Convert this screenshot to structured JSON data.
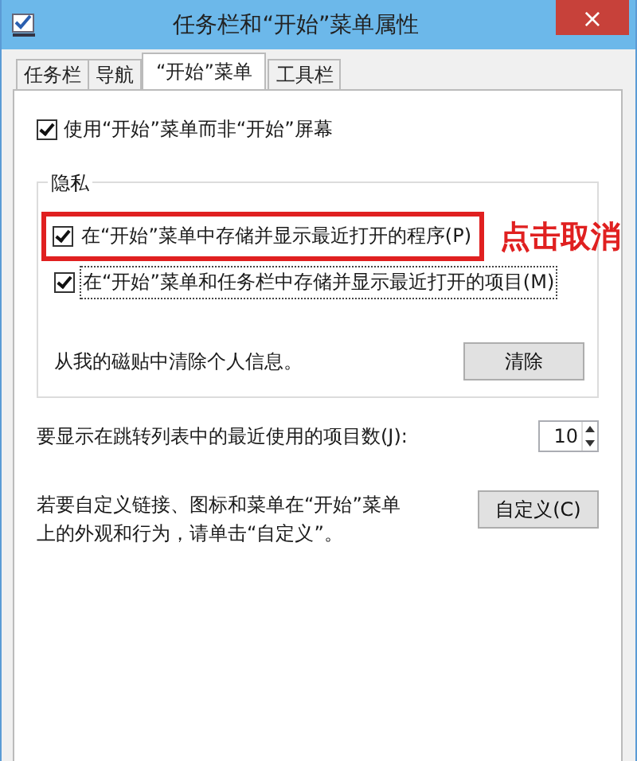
{
  "window": {
    "title": "任务栏和“开始”菜单属性",
    "close": "×"
  },
  "tabs": [
    {
      "label": "任务栏",
      "selected": false
    },
    {
      "label": "导航",
      "selected": false
    },
    {
      "label": "“开始”菜单",
      "selected": true
    },
    {
      "label": "工具栏",
      "selected": false
    }
  ],
  "use_start_menu": {
    "label": "使用“开始”菜单而非“开始”屏幕",
    "checked": true
  },
  "privacy": {
    "title": "隐私",
    "items": [
      {
        "label": "在“开始”菜单中存储并显示最近打开的程序(P)",
        "checked": true,
        "focused": false,
        "highlighted": true
      },
      {
        "label": "在“开始”菜单和任务栏中存储并显示最近打开的项目(M)",
        "checked": true,
        "focused": true,
        "highlighted": false
      }
    ],
    "clear_text": "从我的磁贴中清除个人信息。",
    "clear_button": "清除"
  },
  "annotation": "点击取消",
  "jump_list": {
    "label": "要显示在跳转列表中的最近使用的项目数(J):",
    "value": "10"
  },
  "customize": {
    "text": "若要自定义链接、图标和菜单在“开始”菜单上的外观和行为，请单击“自定义”。",
    "button": "自定义(C)"
  }
}
